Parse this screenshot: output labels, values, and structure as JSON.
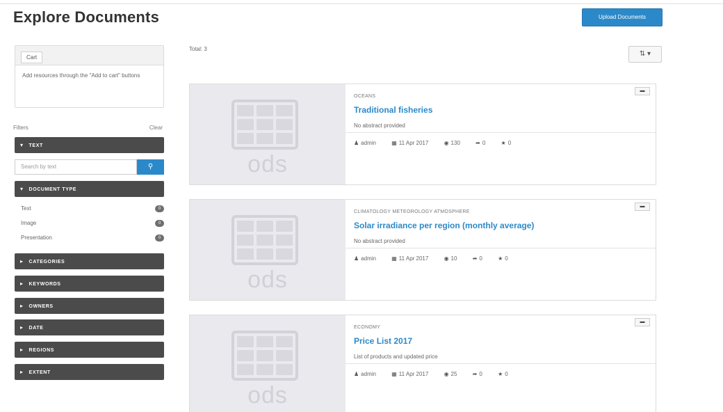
{
  "header": {
    "title": "Explore Documents",
    "upload_label": "Upload Documents"
  },
  "cart": {
    "tab_label": "Cart",
    "message": "Add resources through the \"Add to cart\" buttons"
  },
  "filters": {
    "label": "Filters",
    "clear_label": "Clear",
    "text_section": "TEXT",
    "search_placeholder": "Search by text",
    "doctype_section": "DOCUMENT TYPE",
    "doc_types": [
      {
        "label": "Text",
        "count": "0"
      },
      {
        "label": "Image",
        "count": "0"
      },
      {
        "label": "Presentation",
        "count": "0"
      }
    ],
    "collapsed_sections": [
      "CATEGORIES",
      "KEYWORDS",
      "OWNERS",
      "DATE",
      "REGIONS",
      "EXTENT"
    ]
  },
  "main": {
    "total_label": "Total: 3",
    "sort_icon": "sort-icon"
  },
  "documents": [
    {
      "category": "OCEANS",
      "title": "Traditional fisheries",
      "abstract": "No abstract provided",
      "owner": "admin",
      "date": "11 Apr 2017",
      "views": "130",
      "shares": "0",
      "rating": "0",
      "thumb_label": "ods"
    },
    {
      "category": "CLIMATOLOGY METEOROLOGY ATMOSPHERE",
      "title": "Solar irradiance per region (monthly average)",
      "abstract": "No abstract provided",
      "owner": "admin",
      "date": "11 Apr 2017",
      "views": "10",
      "shares": "0",
      "rating": "0",
      "thumb_label": "ods"
    },
    {
      "category": "ECONOMY",
      "title": "Price List 2017",
      "abstract": "List of products and updated price",
      "owner": "admin",
      "date": "11 Apr 2017",
      "views": "25",
      "shares": "0",
      "rating": "0",
      "thumb_label": "ods"
    }
  ],
  "colors": {
    "accent": "#2c89c9",
    "sidebar_bar": "#4b4b4b"
  }
}
